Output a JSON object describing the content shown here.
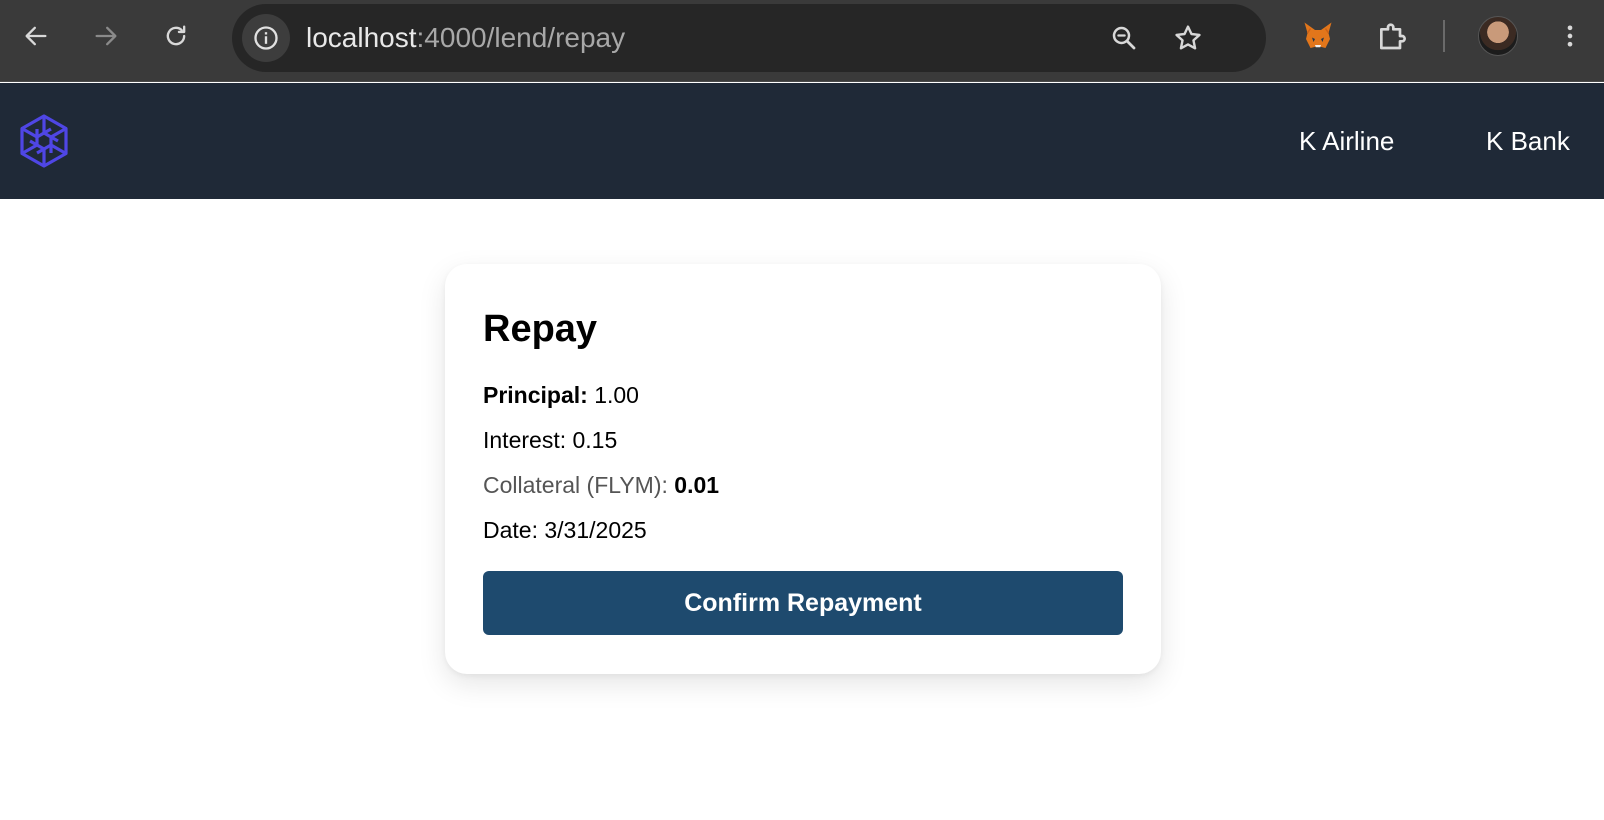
{
  "browser": {
    "url_host": "localhost",
    "url_rest": ":4000/lend/repay",
    "icons": {
      "back": "back-arrow-icon",
      "forward": "forward-arrow-icon",
      "reload": "reload-icon",
      "site_info": "info-icon",
      "zoom": "zoom-icon",
      "bookmark": "star-icon",
      "extension_metamask": "fox-icon",
      "extensions": "puzzle-icon",
      "menu": "kebab-menu-icon"
    }
  },
  "header": {
    "logo": "hexagon-logo",
    "nav": [
      {
        "label": "K Airline"
      },
      {
        "label": "K Bank"
      }
    ],
    "bg_color": "#1f2937"
  },
  "repay": {
    "title": "Repay",
    "principal": {
      "label": "Principal:",
      "value": "1.00"
    },
    "interest": {
      "label": "Interest:",
      "value": "0.15"
    },
    "collateral": {
      "label": "Collateral (FLYM):",
      "value": "0.01"
    },
    "date": {
      "label": "Date:",
      "value": "3/31/2025"
    },
    "confirm_label": "Confirm Repayment",
    "button_color": "#1e4a6e"
  }
}
